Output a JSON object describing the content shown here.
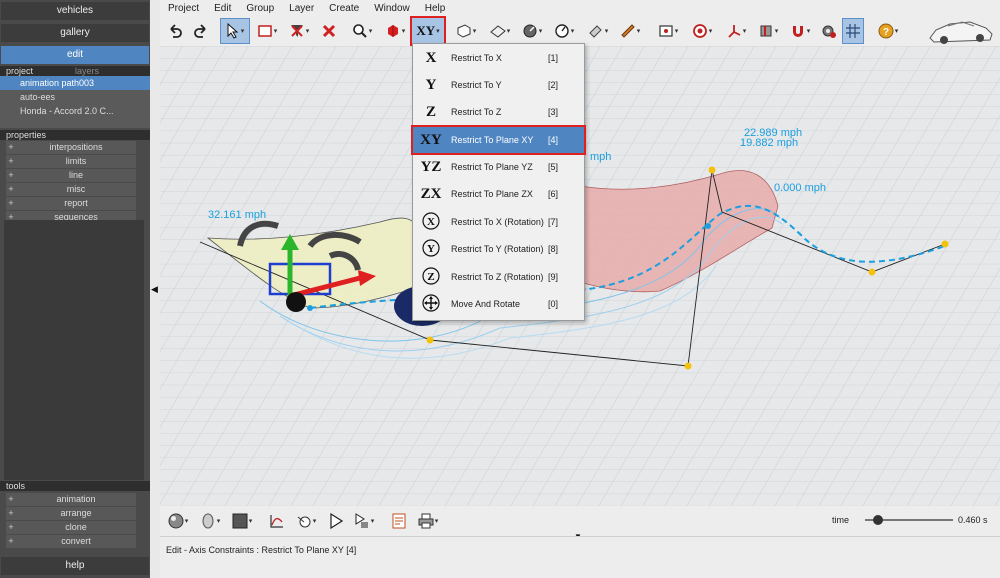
{
  "sidebar": {
    "nav": [
      {
        "label": "vehicles"
      },
      {
        "label": "gallery"
      },
      {
        "label": "edit"
      }
    ],
    "project_tabs": {
      "project": "project",
      "layers": "layers"
    },
    "project_items": [
      {
        "label": "animation path003"
      },
      {
        "label": "auto-ees"
      },
      {
        "label": "Honda - Accord 2.0 C..."
      }
    ],
    "properties_title": "properties",
    "properties": [
      {
        "label": "interpositions"
      },
      {
        "label": "limits"
      },
      {
        "label": "line"
      },
      {
        "label": "misc"
      },
      {
        "label": "report"
      },
      {
        "label": "sequences"
      }
    ],
    "tools_title": "tools",
    "tools": [
      {
        "label": "animation"
      },
      {
        "label": "arrange"
      },
      {
        "label": "clone"
      },
      {
        "label": "convert"
      }
    ],
    "help": "help"
  },
  "menubar": [
    {
      "label": "Project"
    },
    {
      "label": "Edit"
    },
    {
      "label": "Group"
    },
    {
      "label": "Layer"
    },
    {
      "label": "Create"
    },
    {
      "label": "Window"
    },
    {
      "label": "Help"
    }
  ],
  "toolbar": {
    "axis_button_label": "XY"
  },
  "dropdown": {
    "items": [
      {
        "icon": "X",
        "label": "Restrict To X",
        "key": "[1]"
      },
      {
        "icon": "Y",
        "label": "Restrict To Y",
        "key": "[2]"
      },
      {
        "icon": "Z",
        "label": "Restrict To Z",
        "key": "[3]"
      },
      {
        "icon": "XY",
        "label": "Restrict To Plane XY",
        "key": "[4]"
      },
      {
        "icon": "YZ",
        "label": "Restrict To Plane YZ",
        "key": "[5]"
      },
      {
        "icon": "ZX",
        "label": "Restrict To Plane ZX",
        "key": "[6]"
      },
      {
        "icon": "X",
        "label": "Restrict To X (Rotation)",
        "key": "[7]"
      },
      {
        "icon": "Y",
        "label": "Restrict To Y (Rotation)",
        "key": "[8]"
      },
      {
        "icon": "Z",
        "label": "Restrict To Z (Rotation)",
        "key": "[9]"
      },
      {
        "icon": "move-rotate",
        "label": "Move And Rotate",
        "key": "[0]"
      }
    ],
    "selected_index": 3
  },
  "viewport": {
    "speed_labels": {
      "left": "32.161 mph",
      "partial": "mph",
      "top_1": "22.989 mph",
      "top_2": "19.882 mph",
      "right": "0.000 mph"
    }
  },
  "status": {
    "text": "Edit - Axis Constraints : Restrict To Plane XY [4]",
    "time_label": "time",
    "time_value": "0.460 s",
    "time_fraction": 0.1
  },
  "colors": {
    "accent": "#4f86c2",
    "highlight": "#e02020",
    "speed_text": "#1a9fe0"
  }
}
